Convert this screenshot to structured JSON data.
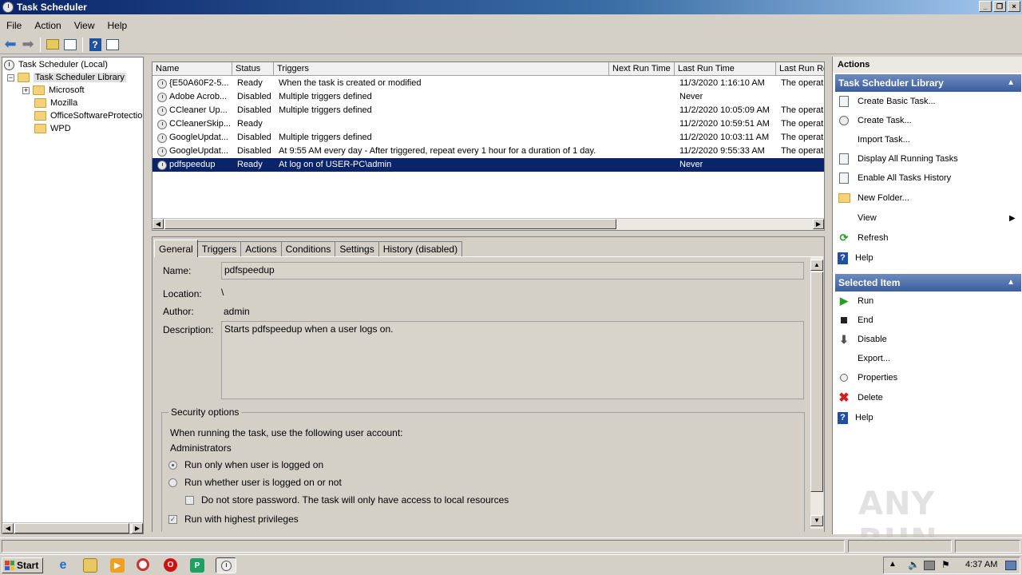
{
  "window": {
    "title": "Task Scheduler"
  },
  "menu": [
    "File",
    "Action",
    "View",
    "Help"
  ],
  "tree": {
    "root": "Task Scheduler (Local)",
    "library": "Task Scheduler Library",
    "folders": [
      "Microsoft",
      "Mozilla",
      "OfficeSoftwareProtectio",
      "WPD"
    ]
  },
  "tasklist": {
    "columns": [
      "Name",
      "Status",
      "Triggers",
      "Next Run Time",
      "Last Run Time",
      "Last Run Re"
    ],
    "rows": [
      {
        "name": "{E50A60F2-5...",
        "status": "Ready",
        "triggers": "When the task is created or modified",
        "next": "",
        "last": "11/3/2020 1:16:10 AM",
        "result": "The operati"
      },
      {
        "name": "Adobe Acrob...",
        "status": "Disabled",
        "triggers": "Multiple triggers defined",
        "next": "",
        "last": "Never",
        "result": ""
      },
      {
        "name": "CCleaner Up...",
        "status": "Disabled",
        "triggers": "Multiple triggers defined",
        "next": "",
        "last": "11/2/2020 10:05:09 AM",
        "result": "The operati"
      },
      {
        "name": "CCleanerSkip...",
        "status": "Ready",
        "triggers": "",
        "next": "",
        "last": "11/2/2020 10:59:51 AM",
        "result": "The operati"
      },
      {
        "name": "GoogleUpdat...",
        "status": "Disabled",
        "triggers": "Multiple triggers defined",
        "next": "",
        "last": "11/2/2020 10:03:11 AM",
        "result": "The operati"
      },
      {
        "name": "GoogleUpdat...",
        "status": "Disabled",
        "triggers": "At 9:55 AM every day - After triggered, repeat every 1 hour for a duration of 1 day.",
        "next": "",
        "last": "11/2/2020 9:55:33 AM",
        "result": "The operati"
      },
      {
        "name": "pdfspeedup",
        "status": "Ready",
        "triggers": "At log on of USER-PC\\admin",
        "next": "",
        "last": "Never",
        "result": ""
      }
    ]
  },
  "detail": {
    "tabs": [
      "General",
      "Triggers",
      "Actions",
      "Conditions",
      "Settings",
      "History (disabled)"
    ],
    "name_label": "Name:",
    "name_value": "pdfspeedup",
    "location_label": "Location:",
    "location_value": "\\",
    "author_label": "Author:",
    "author_value": "admin",
    "description_label": "Description:",
    "description_value": "Starts pdfspeedup when a user logs on.",
    "security": {
      "title": "Security options",
      "account_prompt": "When running the task, use the following user account:",
      "account": "Administrators",
      "opt_logged_on": "Run only when user is logged on",
      "opt_whether": "Run whether user is logged on or not",
      "opt_no_store": "Do not store password.  The task will only have access to local resources",
      "opt_highest": "Run with highest privileges"
    }
  },
  "actions": {
    "header": "Actions",
    "library_section": "Task Scheduler Library",
    "library_items": [
      "Create Basic Task...",
      "Create Task...",
      "Import Task...",
      "Display All Running Tasks",
      "Enable All Tasks History",
      "New Folder...",
      "View",
      "Refresh",
      "Help"
    ],
    "selected_section": "Selected Item",
    "selected_items": [
      "Run",
      "End",
      "Disable",
      "Export...",
      "Properties",
      "Delete",
      "Help"
    ]
  },
  "taskbar": {
    "start": "Start",
    "clock": "4:37 AM"
  },
  "watermark": "ANY RUN"
}
